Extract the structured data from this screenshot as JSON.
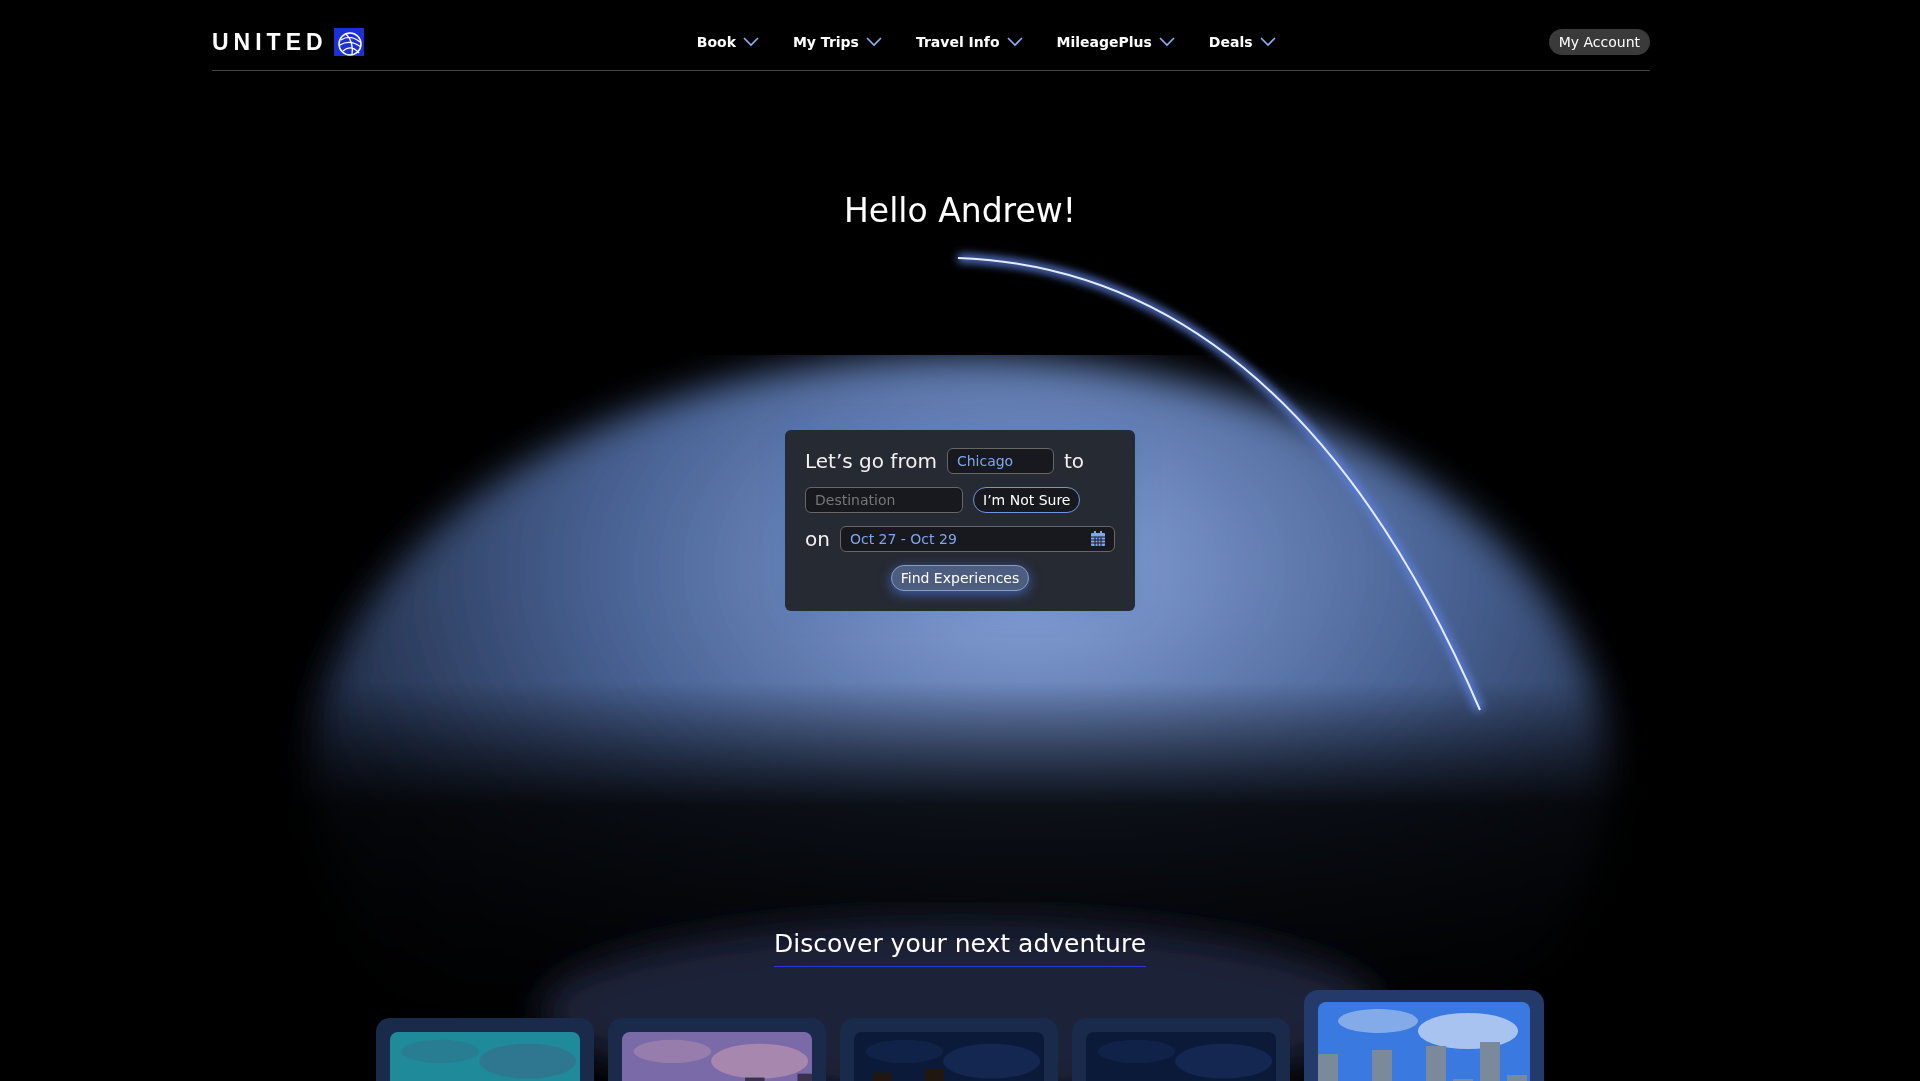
{
  "header": {
    "logo": "UNITED",
    "nav": [
      {
        "label": "Book"
      },
      {
        "label": "My Trips"
      },
      {
        "label": "Travel Info"
      },
      {
        "label": "MileagePlus"
      },
      {
        "label": "Deals"
      }
    ],
    "account_button": "My Account"
  },
  "hero": {
    "greeting": "Hello Andrew!",
    "form": {
      "from_label": "Let’s go from",
      "origin": {
        "value": "Chicago"
      },
      "to_label": "to",
      "destination": {
        "placeholder": "Destination"
      },
      "not_sure_button": "I’m Not Sure",
      "on_label": "on",
      "dates": {
        "value": "Oct 27 - Oct 29"
      },
      "submit_button": "Find Experiences"
    }
  },
  "discover": {
    "title": "Discover your next adventure",
    "cards": [
      {
        "kind": "picture",
        "selected": false
      },
      {
        "kind": "picture",
        "selected": false
      },
      {
        "kind": "picture",
        "selected": false
      },
      {
        "kind": "picture",
        "selected": false
      },
      {
        "kind": "picture",
        "selected": true
      }
    ]
  }
}
